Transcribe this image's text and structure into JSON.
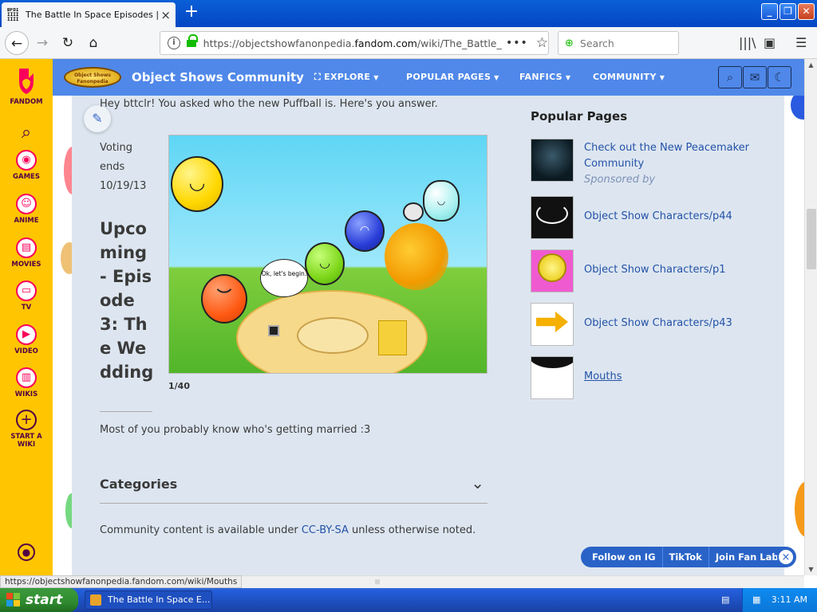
{
  "browser": {
    "tab_title": "The Battle In Space Episodes | Object",
    "tab_close": "×",
    "new_tab": "+",
    "url_prefix": "https://objectshowfanonpedia.",
    "url_domain": "fandom.com",
    "url_suffix": "/wiki/The_Battle_",
    "page_actions": "•••",
    "search_placeholder": "Search",
    "status_url": "https://objectshowfanonpedia.fandom.com/wiki/Mouths"
  },
  "rail": {
    "items": [
      {
        "label": "FANDOM",
        "icon": "fandom-heart-icon"
      },
      {
        "label": "",
        "icon": "search-icon"
      },
      {
        "label": "GAMES",
        "icon": "gamepad-icon"
      },
      {
        "label": "ANIME",
        "icon": "anime-icon"
      },
      {
        "label": "MOVIES",
        "icon": "clapperboard-icon"
      },
      {
        "label": "TV",
        "icon": "tv-icon"
      },
      {
        "label": "VIDEO",
        "icon": "play-icon"
      },
      {
        "label": "WIKIS",
        "icon": "book-icon"
      },
      {
        "label": "START A WIKI",
        "icon": "plus-circle-icon"
      }
    ]
  },
  "wiki_header": {
    "logo_text": "Object Shows Fanonpedia",
    "community_name": "Object Shows Community",
    "nav": [
      {
        "label": "EXPLORE"
      },
      {
        "label": "POPULAR PAGES"
      },
      {
        "label": "FANFICS"
      },
      {
        "label": "COMMUNITY"
      }
    ]
  },
  "article": {
    "intro_text": "Hey bttclr! You asked who the new Puffball is. Here's you answer.",
    "voting_text": "Voting ends 10/19/13",
    "upcoming_heading": "Upcoming - Episode 3: The Wedding",
    "gallery_counter": "1/40",
    "speech_bubble": "Ok, let's begin.",
    "description": "Most of you probably know who's getting married :3",
    "categories_label": "Categories",
    "license_prefix": "Community content is available under ",
    "license_link": "CC-BY-SA",
    "license_suffix": " unless otherwise noted."
  },
  "popular_pages": {
    "title": "Popular Pages",
    "items": [
      {
        "label": "Check out the New Peacemaker Community",
        "sponsored": "Sponsored by"
      },
      {
        "label": "Object Show Characters/p44"
      },
      {
        "label": "Object Show Characters/p1"
      },
      {
        "label": "Object Show Characters/p43"
      },
      {
        "label": "Mouths"
      }
    ]
  },
  "follow_bar": {
    "items": [
      "Follow on IG",
      "TikTok",
      "Join Fan Lab"
    ],
    "close": "×"
  },
  "taskbar": {
    "start": "start",
    "task_item": "The Battle In Space E...",
    "clock": "3:11 AM"
  },
  "colors": {
    "fandom_rail": "#ffc500",
    "wiki_header": "#4f88e9",
    "content_bg": "#dde6f0",
    "link": "#2452a8"
  }
}
